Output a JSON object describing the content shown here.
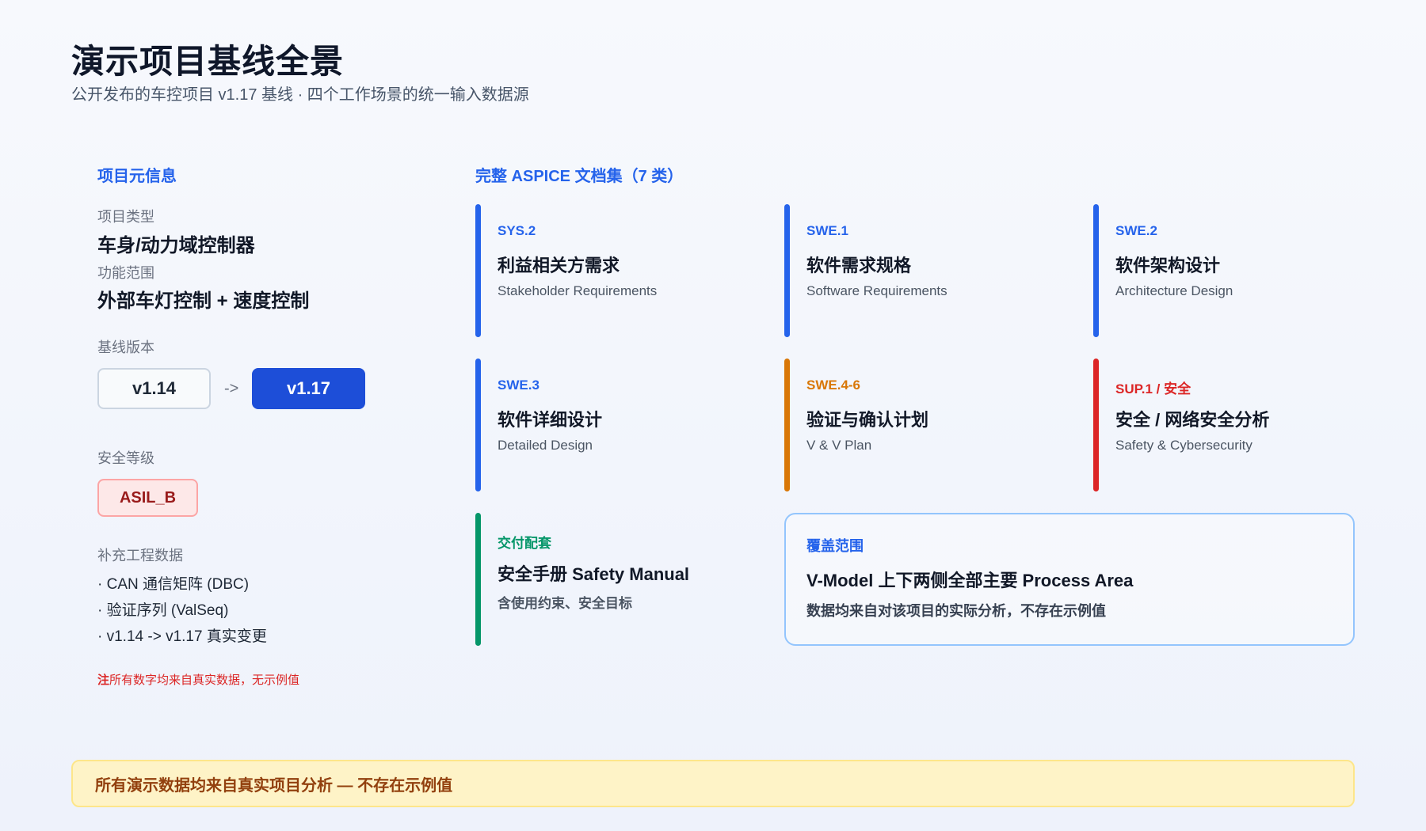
{
  "header": {
    "title": "演示项目基线全景",
    "subtitle": "公开发布的车控项目 v1.17 基线 · 四个工作场景的统一输入数据源"
  },
  "meta": {
    "heading": "项目元信息",
    "project_type_label": "项目类型",
    "project_type_value": "车身/动力域控制器",
    "scope_label": "功能范围",
    "scope_value": "外部车灯控制 + 速度控制",
    "baseline_label": "基线版本",
    "baseline_from": "v1.14",
    "baseline_arrow": "->",
    "baseline_to": "v1.17",
    "safety_label": "安全等级",
    "safety_value": "ASIL_B",
    "extra_label": "补充工程数据",
    "extra_items": [
      "· CAN 通信矩阵 (DBC)",
      "· 验证序列 (ValSeq)",
      "· v1.14 -> v1.17 真实变更"
    ],
    "note_prefix": "注",
    "note_text": "所有数字均来自真实数据，无示例值"
  },
  "docs": {
    "heading": "完整 ASPICE 文档集（7 类）",
    "cards": [
      {
        "code": "SYS.2",
        "title": "利益相关方需求",
        "en": "Stakeholder Requirements",
        "color": "#2563eb"
      },
      {
        "code": "SWE.1",
        "title": "软件需求规格",
        "en": "Software Requirements",
        "color": "#2563eb"
      },
      {
        "code": "SWE.2",
        "title": "软件架构设计",
        "en": "Architecture Design",
        "color": "#2563eb"
      },
      {
        "code": "SWE.3",
        "title": "软件详细设计",
        "en": "Detailed Design",
        "color": "#2563eb"
      },
      {
        "code": "SWE.4-6",
        "title": "验证与确认计划",
        "en": "V & V Plan",
        "color": "#d97706"
      },
      {
        "code": "SUP.1 / 安全",
        "title": "安全 / 网络安全分析",
        "en": "Safety & Cybersecurity",
        "color": "#dc2626"
      },
      {
        "code": "交付配套",
        "title": "安全手册 Safety Manual",
        "en": "含使用约束、安全目标",
        "color": "#059669"
      }
    ],
    "coverage": {
      "label": "覆盖范围",
      "title": "V-Model 上下两侧全部主要 Process Area",
      "desc": "数据均来自对该项目的实际分析，不存在示例值"
    }
  },
  "footer": {
    "banner": "所有演示数据均来自真实项目分析 — 不存在示例值"
  }
}
